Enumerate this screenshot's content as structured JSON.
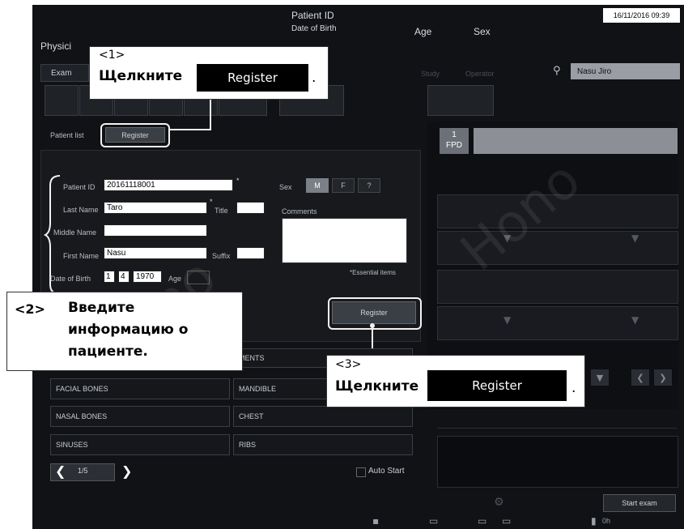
{
  "header": {
    "patient_id_label": "Patient ID",
    "dob_label": "Date of Birth",
    "age_label": "Age",
    "sex_label": "Sex",
    "datetime": "16/11/2016 09:39",
    "physician_label": "Physici",
    "exam_tab": "Exam",
    "study_label": "Study",
    "operator_label": "Operator",
    "operator_name": "Nasu Jiro"
  },
  "left": {
    "patient_list_label": "Patient list",
    "register_top": "Register",
    "patient_id_label": "Patient ID",
    "patient_id_value": "20161118001",
    "last_name_label": "Last Name",
    "last_name_value": "Taro",
    "title_label": "Title",
    "middle_name_label": "Middle Name",
    "middle_name_value": "",
    "first_name_label": "First Name",
    "first_name_value": "Nasu",
    "suffix_label": "Suffix",
    "dob_label": "Date of Birth",
    "dob_day": "1",
    "dob_month": "4",
    "dob_year": "1970",
    "age_label": "Age",
    "sex_label": "Sex",
    "sex_m": "M",
    "sex_f": "F",
    "sex_q": "?",
    "comments_label": "Comments",
    "essential_note": "*Essential items",
    "register_bottom": "Register",
    "asterisk": "*",
    "asterisk2": "*"
  },
  "exam_list": {
    "items": [
      "",
      "FACIAL BONES",
      "NASAL BONES",
      "SINUSES"
    ],
    "items_right": [
      "MENTS",
      "MANDIBLE",
      "CHEST",
      "RIBS"
    ],
    "page": "1/5",
    "auto_start": "Auto Start"
  },
  "right": {
    "fpd_label": "FPD",
    "fpd_num": "1",
    "start_exam": "Start exam",
    "bottom_num": "0h"
  },
  "callouts": {
    "c1_num": "<1>",
    "c1_text": "Щелкните",
    "c1_btn": "Register",
    "c1_end": ".",
    "c2_num": "<2>",
    "c2_text1": "Введите",
    "c2_text2": "информацию о",
    "c2_text3": "пациенте.",
    "c3_num": "<3>",
    "c3_text": "Щелкните",
    "c3_btn": "Register",
    "c3_end": "."
  },
  "colors": {
    "background": "#101216",
    "field": "#ffffff",
    "callout_bg": "#ffffff",
    "button_black": "#000000",
    "fpd_bar": "#8c9096"
  }
}
